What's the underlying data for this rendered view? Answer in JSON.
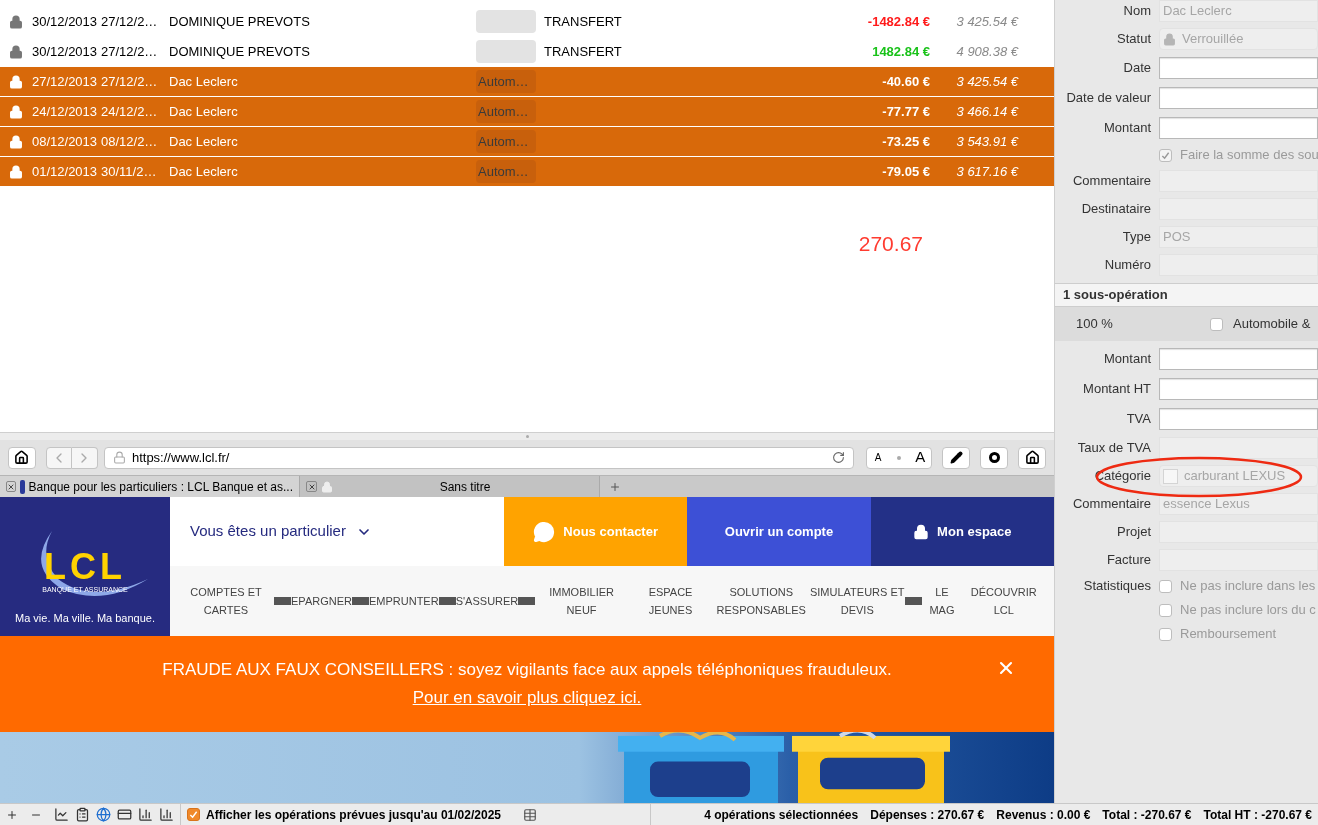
{
  "transactions": [
    {
      "locked": true,
      "selected": false,
      "date": "30/12/2013",
      "value_date": "27/12/2…",
      "name": "DOMINIQUE PREVOTS",
      "type": "TRANSFERT",
      "amount": "-1482.84 €",
      "color": "#ff1a1a",
      "balance": "3 425.54 €"
    },
    {
      "locked": true,
      "selected": false,
      "date": "30/12/2013",
      "value_date": "27/12/2…",
      "name": "DOMINIQUE PREVOTS",
      "type": "TRANSFERT",
      "amount": "1482.84 €",
      "color": "#19c219",
      "balance": "4 908.38 €"
    },
    {
      "locked": true,
      "selected": true,
      "date": "27/12/2013",
      "value_date": "27/12/2…",
      "name": "Dac Leclerc",
      "category": "Autom…",
      "amount": "-40.60 €",
      "balance": "3 425.54 €"
    },
    {
      "locked": true,
      "selected": true,
      "date": "24/12/2013",
      "value_date": "24/12/2…",
      "name": "Dac Leclerc",
      "category": "Autom…",
      "amount": "-77.77 €",
      "balance": "3 466.14 €"
    },
    {
      "locked": true,
      "selected": true,
      "date": "08/12/2013",
      "value_date": "08/12/2…",
      "name": "Dac Leclerc",
      "category": "Autom…",
      "amount": "-73.25 €",
      "balance": "3 543.91 €"
    },
    {
      "locked": true,
      "selected": true,
      "date": "01/12/2013",
      "value_date": "30/11/2…",
      "name": "Dac Leclerc",
      "category": "Autom…",
      "amount": "-79.05 €",
      "balance": "3 617.16 €"
    }
  ],
  "selection_total": "270.67",
  "browser": {
    "url": "https://www.lcl.fr/",
    "font_buttons": [
      "A",
      "A"
    ],
    "tabs": [
      {
        "title": "Banque pour les particuliers : LCL Banque et as...",
        "selected": true,
        "secure": false
      },
      {
        "title": "Sans titre",
        "selected": false,
        "secure": true
      }
    ]
  },
  "lcl": {
    "logo": "LCL",
    "logo_sub": "BANQUE ET ASSURANCE",
    "tagline": "Ma vie. Ma ville. Ma banque.",
    "audience": "Vous êtes un particulier",
    "actions": [
      {
        "kind": "contact",
        "label": "Nous contacter"
      },
      {
        "kind": "open",
        "label": "Ouvrir un compte"
      },
      {
        "kind": "space",
        "label": "Mon espace"
      }
    ],
    "menu": [
      {
        "kind": "item",
        "label": "COMPTES ET CARTES"
      },
      {
        "kind": "divider"
      },
      {
        "kind": "item",
        "label": "EPARGNER"
      },
      {
        "kind": "divider"
      },
      {
        "kind": "item",
        "label": "EMPRUNTER"
      },
      {
        "kind": "divider"
      },
      {
        "kind": "item",
        "label": "S'ASSURER"
      },
      {
        "kind": "divider"
      },
      {
        "kind": "item",
        "label": "IMMOBILIER NEUF"
      },
      {
        "kind": "item",
        "label": "ESPACE JEUNES"
      },
      {
        "kind": "item",
        "label": "SOLUTIONS RESPONSABLES"
      },
      {
        "kind": "item",
        "label": "SIMULATEURS ET DEVIS"
      },
      {
        "kind": "divider"
      },
      {
        "kind": "item",
        "label": "LE MAG"
      },
      {
        "kind": "item",
        "label": "DÉCOUVRIR LCL"
      }
    ],
    "alert": {
      "text": "FRAUDE AUX FAUX CONSEILLERS : soyez vigilants face aux appels téléphoniques frauduleux.",
      "link": "Pour en savoir plus cliquez ici."
    }
  },
  "inspector": {
    "fields": [
      {
        "kind": "field",
        "label": "Nom",
        "value": "Dac Leclerc",
        "disabled": true
      },
      {
        "kind": "status",
        "label": "Statut",
        "value": "Verrouillée",
        "disabled": true
      },
      {
        "kind": "field",
        "label": "Date",
        "disabled": false
      },
      {
        "kind": "field",
        "label": "Date de valeur",
        "disabled": false
      },
      {
        "kind": "field",
        "label": "Montant",
        "disabled": false
      },
      {
        "kind": "checkbox",
        "label": "Faire la somme des sou",
        "checked": true
      },
      {
        "kind": "field",
        "label": "Commentaire",
        "disabled": true
      },
      {
        "kind": "field",
        "label": "Destinataire",
        "disabled": true
      },
      {
        "kind": "field",
        "label": "Type",
        "value": "POS",
        "disabled": true
      },
      {
        "kind": "field",
        "label": "Numéro",
        "disabled": true
      }
    ],
    "sub_header": "1 sous-opération",
    "sub_row": {
      "share": "100 %",
      "category": "Automobile &",
      "checked": false
    },
    "sub_fields": [
      {
        "kind": "field",
        "label": "Montant",
        "disabled": false
      },
      {
        "kind": "field",
        "label": "Montant HT",
        "disabled": false
      },
      {
        "kind": "field",
        "label": "TVA",
        "disabled": false
      },
      {
        "kind": "field",
        "label": "Taux de TVA",
        "disabled": true
      },
      {
        "kind": "category",
        "label": "Catégorie",
        "value": "carburant LEXUS",
        "disabled": true
      },
      {
        "kind": "field",
        "label": "Commentaire",
        "value": "essence Lexus",
        "disabled": true
      },
      {
        "kind": "field",
        "label": "Projet",
        "disabled": true
      },
      {
        "kind": "field",
        "label": "Facture",
        "disabled": true
      },
      {
        "kind": "checkbox",
        "label": "Ne pas inclure dans les",
        "section": "Statistiques",
        "checked": false
      },
      {
        "kind": "checkbox",
        "label": "Ne pas inclure lors du c",
        "checked": false
      },
      {
        "kind": "checkbox",
        "label": "Remboursement",
        "checked": false
      }
    ]
  },
  "status_bar": {
    "show_planned": {
      "label": "Afficher les opérations prévues jusqu'au 01/02/2025",
      "checked": true
    },
    "summary": "4 opérations sélectionnées",
    "stats": [
      "Dépenses : 270.67 €",
      "Revenus : 0.00 €",
      "Total : -270.67 €",
      "Total HT : -270.67 €"
    ]
  }
}
